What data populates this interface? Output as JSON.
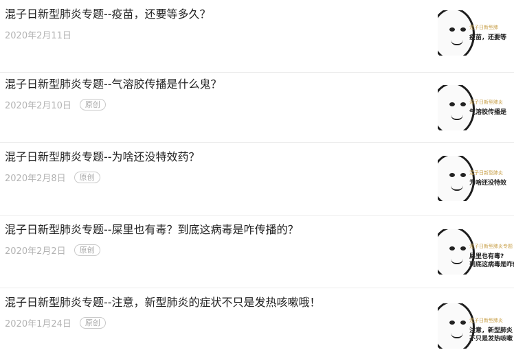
{
  "articles": [
    {
      "title": "混子日新型肺炎专题--疫苗，还要等多久？",
      "date": "2020年2月11日",
      "badge": "",
      "thumb": {
        "brand": "混子日新型肺",
        "line1": "疫苗，还要等",
        "line2": ""
      }
    },
    {
      "title": "混子日新型肺炎专题--气溶胶传播是什么鬼？",
      "date": "2020年2月10日",
      "badge": "原创",
      "thumb": {
        "brand": "混子日新型肺炎",
        "line1": "气溶胶传播是",
        "line2": ""
      }
    },
    {
      "title": "混子日新型肺炎专题--为啥还没特效药？",
      "date": "2020年2月8日",
      "badge": "原创",
      "thumb": {
        "brand": "混子日新型肺炎",
        "line1": "为啥还没特效",
        "line2": ""
      }
    },
    {
      "title": "混子日新型肺炎专题--屎里也有毒？到底这病毒是咋传播的？",
      "date": "2020年2月2日",
      "badge": "原创",
      "thumb": {
        "brand": "混子日新型肺炎专题",
        "line1": "屎里也有毒?",
        "line2": "到底这病毒是咋传"
      }
    },
    {
      "title": "混子日新型肺炎专题--注意，新型肺炎的症状不只是发热咳嗽哦！",
      "date": "2020年1月24日",
      "badge": "原创",
      "thumb": {
        "brand": "混子日新型肺炎",
        "line1": "注意，新型肺炎",
        "line2": "不只是发热咳嗽"
      }
    }
  ]
}
